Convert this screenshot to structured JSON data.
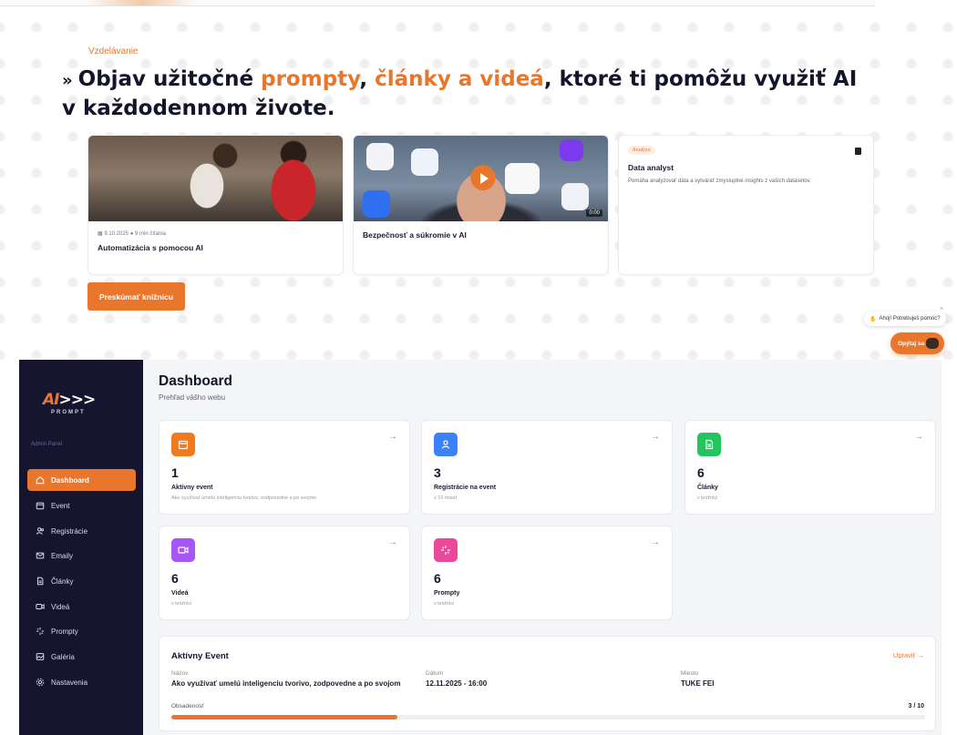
{
  "site": {
    "eyebrow": "Vzdelávanie",
    "headline": {
      "chevron": "»",
      "part1": "Objav užitočné ",
      "accent1": "prompty",
      "part2": ", ",
      "accent2": "články a videá",
      "part3": ", ktoré ti pomôžu využiť AI v každodennom živote."
    },
    "cards": [
      {
        "meta": "▦ 9.10.2025   ● 9 min čítania",
        "title": "Automatizácia s pomocou AI"
      },
      {
        "title": "Bezpečnosť a súkromie v AI",
        "duration": "0:00"
      },
      {
        "tag": "Analýza",
        "title": "Data analyst",
        "description": "Pomáha analyzovať dáta a vytvárať zmysluplné insights z vašich datasetov."
      }
    ],
    "explore_button": "Preskúmať knižnicu",
    "chat": {
      "bubble": "Ahoj! Potrebuješ pomoc?",
      "close": "×",
      "button": "Opýtaj sa"
    }
  },
  "sidebar": {
    "logo_mark": "AI",
    "logo_chevrons": ">>>",
    "logo_sub": "PROMPT",
    "section_label": "Admin Panel",
    "items": [
      {
        "label": "Dashboard",
        "icon": "home-icon"
      },
      {
        "label": "Event",
        "icon": "calendar-icon"
      },
      {
        "label": "Registrácie",
        "icon": "users-icon"
      },
      {
        "label": "Emaily",
        "icon": "mail-icon"
      },
      {
        "label": "Články",
        "icon": "document-icon"
      },
      {
        "label": "Videá",
        "icon": "video-icon"
      },
      {
        "label": "Prompty",
        "icon": "sparkle-icon"
      },
      {
        "label": "Galéria",
        "icon": "image-icon"
      },
      {
        "label": "Nastavenia",
        "icon": "gear-icon"
      }
    ]
  },
  "main": {
    "title": "Dashboard",
    "subtitle": "Prehľad vášho webu",
    "arrow": "→",
    "stats": [
      {
        "value": "1",
        "label": "Aktívny event",
        "hint": "Ako využívať umelú inteligenciu tvorivo, zodpovedne a po svojom",
        "color": "#f07b1e"
      },
      {
        "value": "3",
        "label": "Registrácie na event",
        "hint": "z 10 miest",
        "color": "#3b82f6"
      },
      {
        "value": "6",
        "label": "Články",
        "hint": "v knižnici",
        "color": "#22c55e"
      },
      {
        "value": "6",
        "label": "Videá",
        "hint": "v knižnici",
        "color": "#a855f7"
      },
      {
        "value": "6",
        "label": "Prompty",
        "hint": "v knižnici",
        "color": "#ec4899"
      }
    ],
    "active_event": {
      "title": "Aktívny Event",
      "edit_label": "Upraviť →",
      "name_label": "Názov",
      "name_value": "Ako využívať umelú inteligenciu tvorivo, zodpovedne a po svojom",
      "date_label": "Dátum",
      "date_value": "12.11.2025 - 16:00",
      "place_label": "Miesto",
      "place_value": "TUKE FEI",
      "occupancy_label": "Obsadenosť",
      "occupancy_value": "3 / 10",
      "occupancy_fraction": 0.3
    }
  }
}
